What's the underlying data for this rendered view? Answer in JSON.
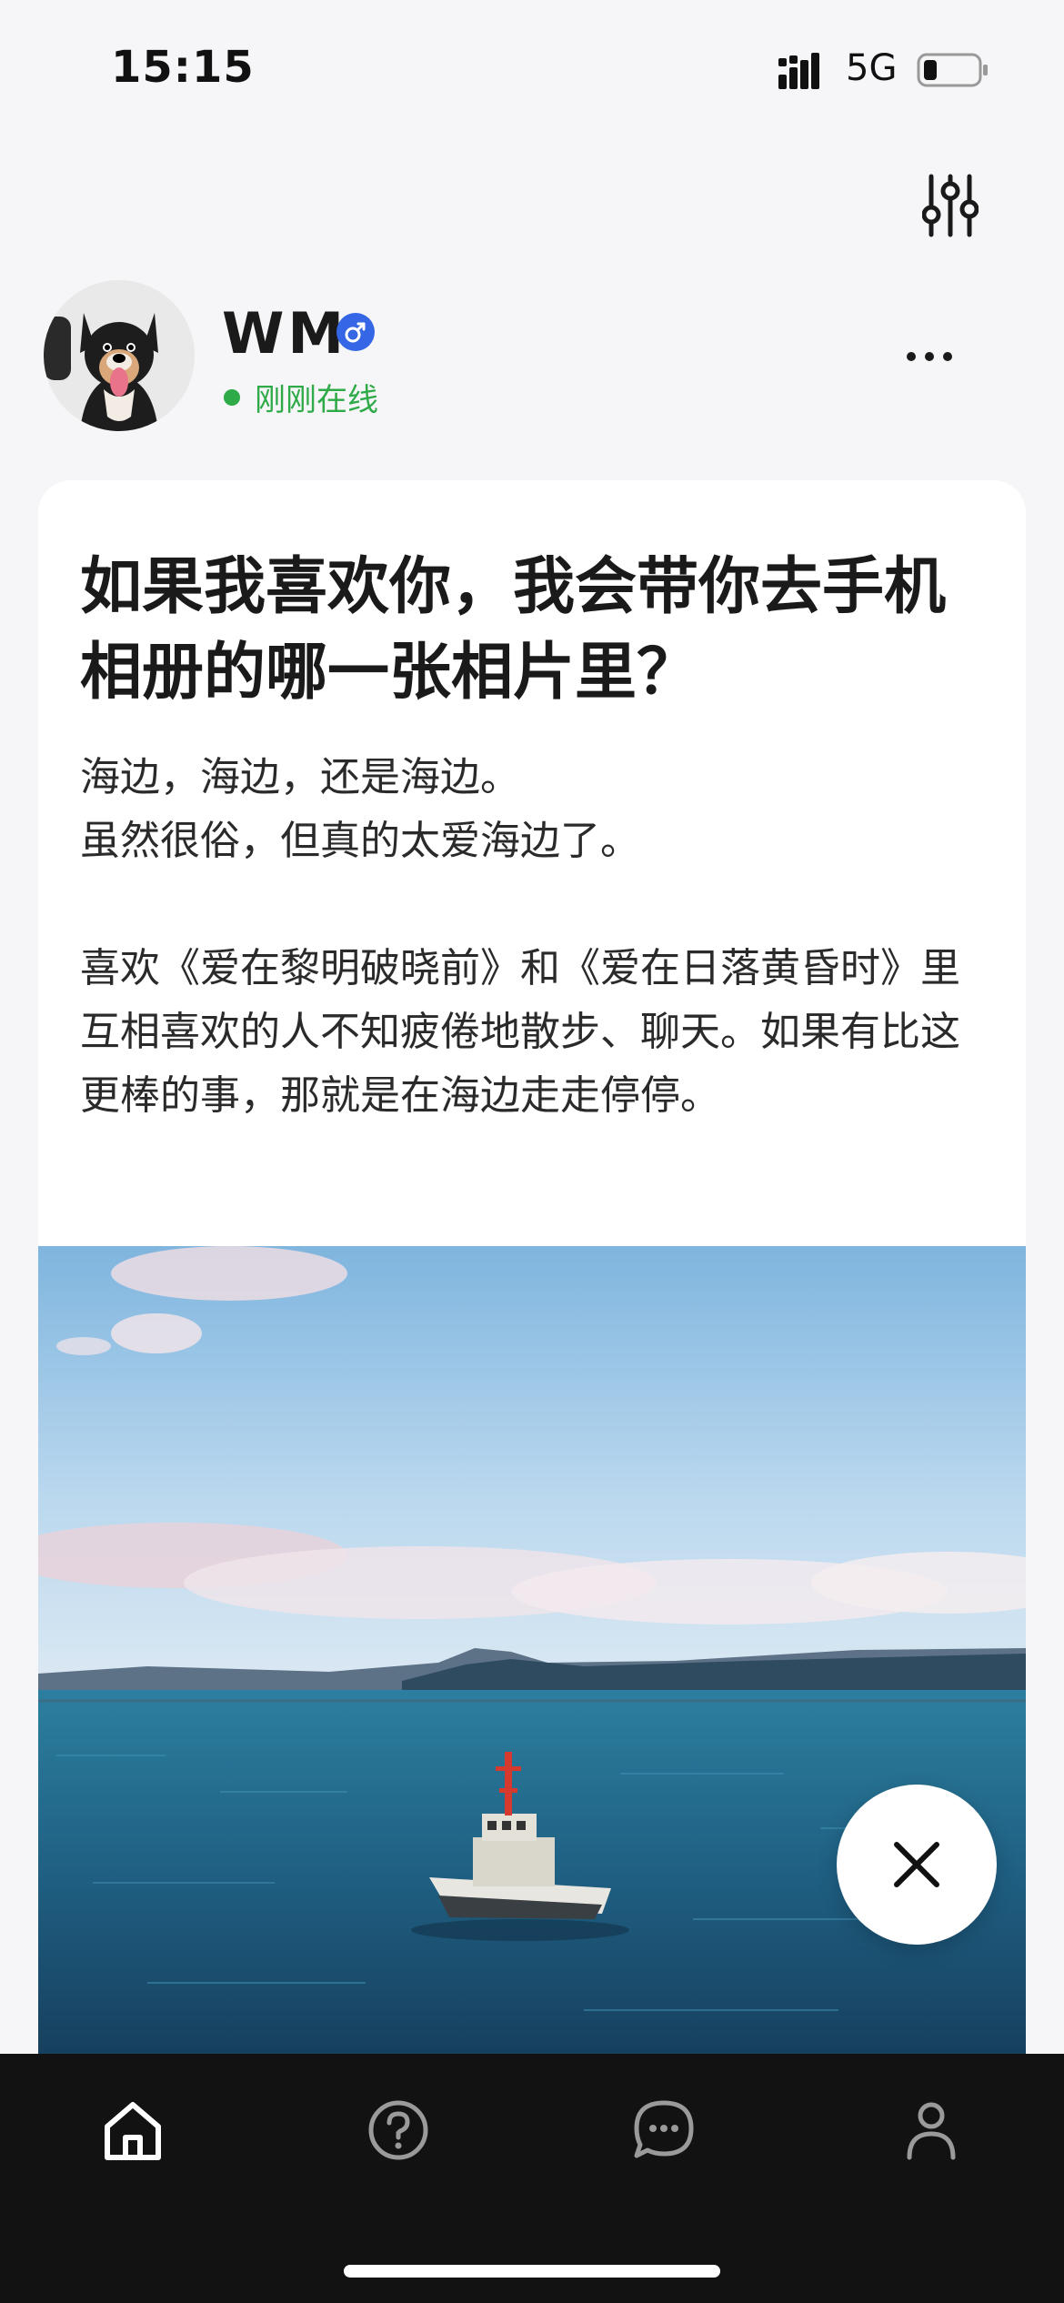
{
  "status_bar": {
    "time": "15:15",
    "network": "5G"
  },
  "profile": {
    "name": "WM",
    "gender_icon": "male-icon",
    "online_status": "刚刚在线",
    "online_color": "#2faa48"
  },
  "post": {
    "title": "如果我喜欢你，我会带你去手机相册的哪一张相片里？",
    "paragraphs": [
      [
        "海边，海边，还是海边。",
        "虽然很俗，但真的太爱海边了。"
      ],
      [
        "喜欢《爱在黎明破晓前》和《爱在日落黄昏时》里互相喜欢的人不知疲倦地散步、聊天。如果有比这更棒的事，那就是在海边走走停停。"
      ]
    ],
    "photo": "sea-tugboat-photo"
  },
  "icons": {
    "filter": "sliders-icon",
    "more": "more-dots-icon",
    "close": "close-icon"
  },
  "bottom_nav": [
    {
      "icon": "home-icon",
      "active": true
    },
    {
      "icon": "question-icon",
      "active": false
    },
    {
      "icon": "chat-icon",
      "active": false
    },
    {
      "icon": "profile-icon",
      "active": false
    }
  ],
  "colors": {
    "accent_blue": "#3466e6",
    "nav_background": "#121212"
  }
}
